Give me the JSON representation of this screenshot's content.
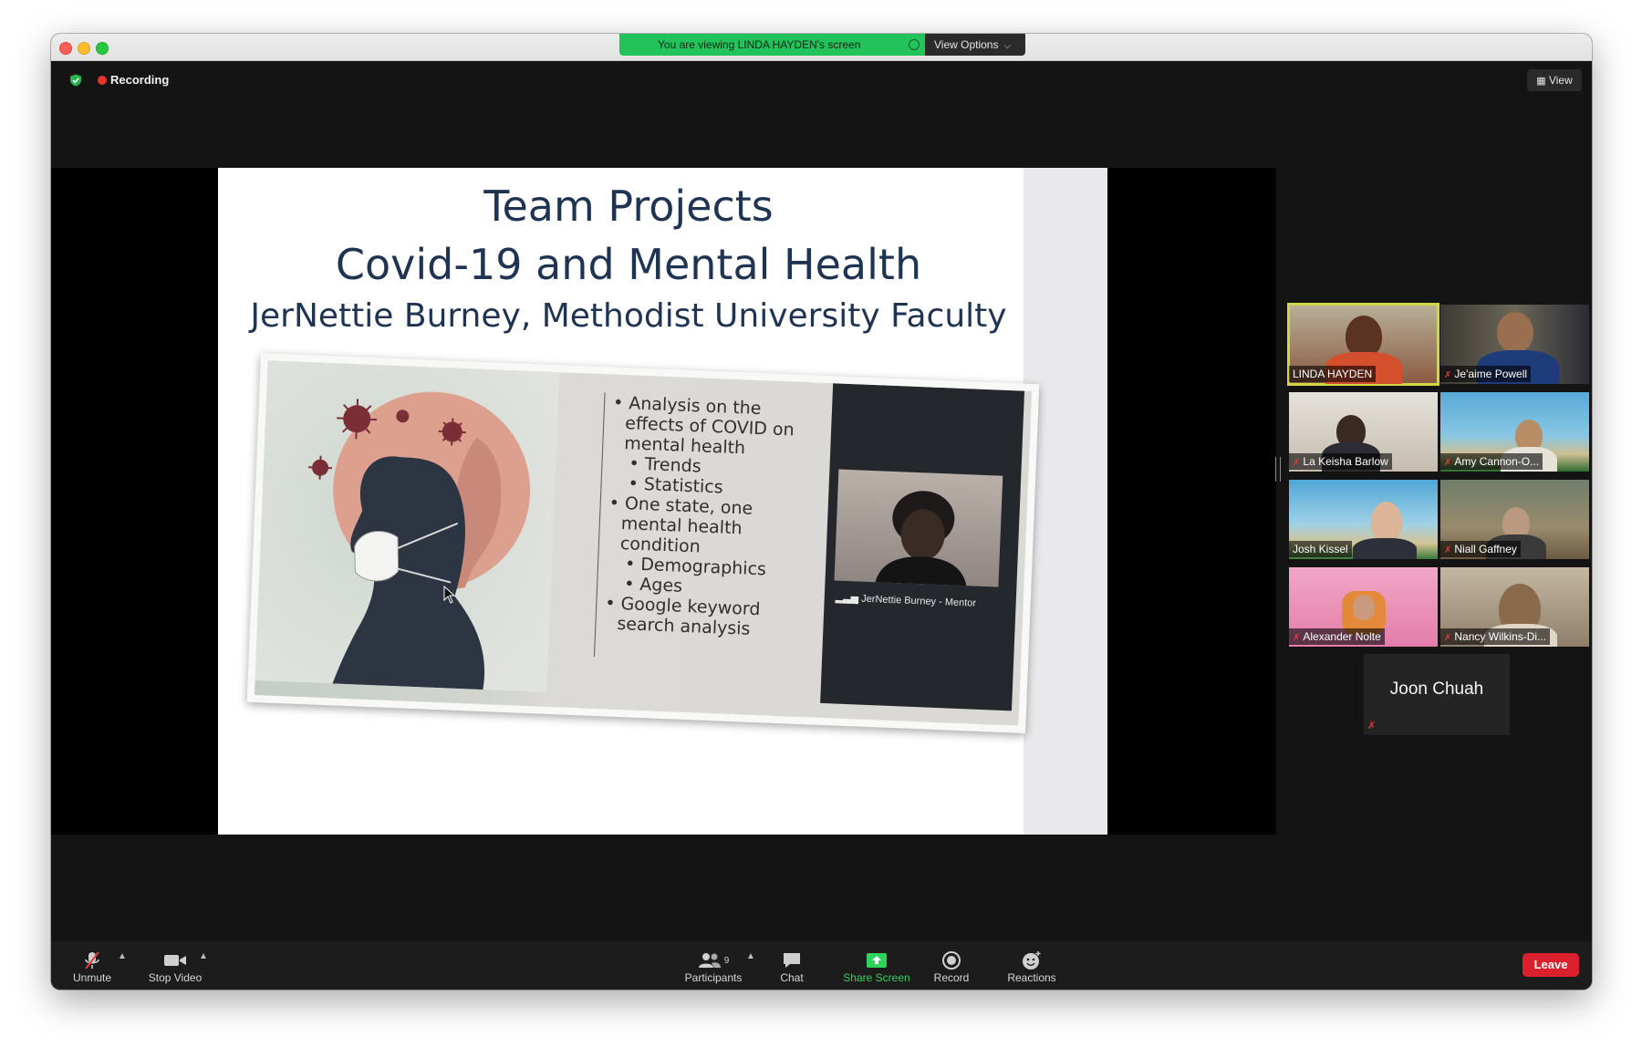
{
  "share_banner": {
    "text": "You are viewing LINDA HAYDEN's screen",
    "view_options": "View Options"
  },
  "status": {
    "recording": "Recording"
  },
  "view_button": "View",
  "slide": {
    "title_line1": "Team Projects",
    "title_line2": "Covid-19 and Mental Health",
    "title_line3": "JerNettie Burney, Methodist University Faculty",
    "bullets": {
      "b1": "Analysis on the effects of COVID on mental health",
      "b1a": "Trends",
      "b1b": "Statistics",
      "b2": "One state, one mental health condition",
      "b2a": "Demographics",
      "b2b": "Ages",
      "b3": "Google keyword search analysis"
    },
    "mentor_label": "JerNettie Burney - Mentor"
  },
  "participants_gallery": [
    {
      "name": "LINDA HAYDEN",
      "muted": false,
      "active": true
    },
    {
      "name": "Je'aime Powell",
      "muted": true,
      "active": false
    },
    {
      "name": "La Keisha Barlow",
      "muted": true,
      "active": false
    },
    {
      "name": "Amy Cannon-O...",
      "muted": true,
      "active": false
    },
    {
      "name": "Josh Kissel",
      "muted": false,
      "active": false
    },
    {
      "name": "Niall Gaffney",
      "muted": true,
      "active": false
    },
    {
      "name": "Alexander Nolte",
      "muted": true,
      "active": false
    },
    {
      "name": "Nancy Wilkins-Di...",
      "muted": true,
      "active": false
    }
  ],
  "joon_tile": {
    "name": "Joon Chuah"
  },
  "toolbar": {
    "unmute": "Unmute",
    "stop_video": "Stop Video",
    "participants": "Participants",
    "participant_count": "9",
    "chat": "Chat",
    "share_screen": "Share Screen",
    "record": "Record",
    "reactions": "Reactions",
    "leave": "Leave"
  },
  "colors": {
    "banner_green": "#22c35a",
    "share_screen_green": "#2fd35a",
    "leave_red": "#d9202c",
    "active_speaker_outline": "#cdd843",
    "slide_title": "#1f3352"
  }
}
